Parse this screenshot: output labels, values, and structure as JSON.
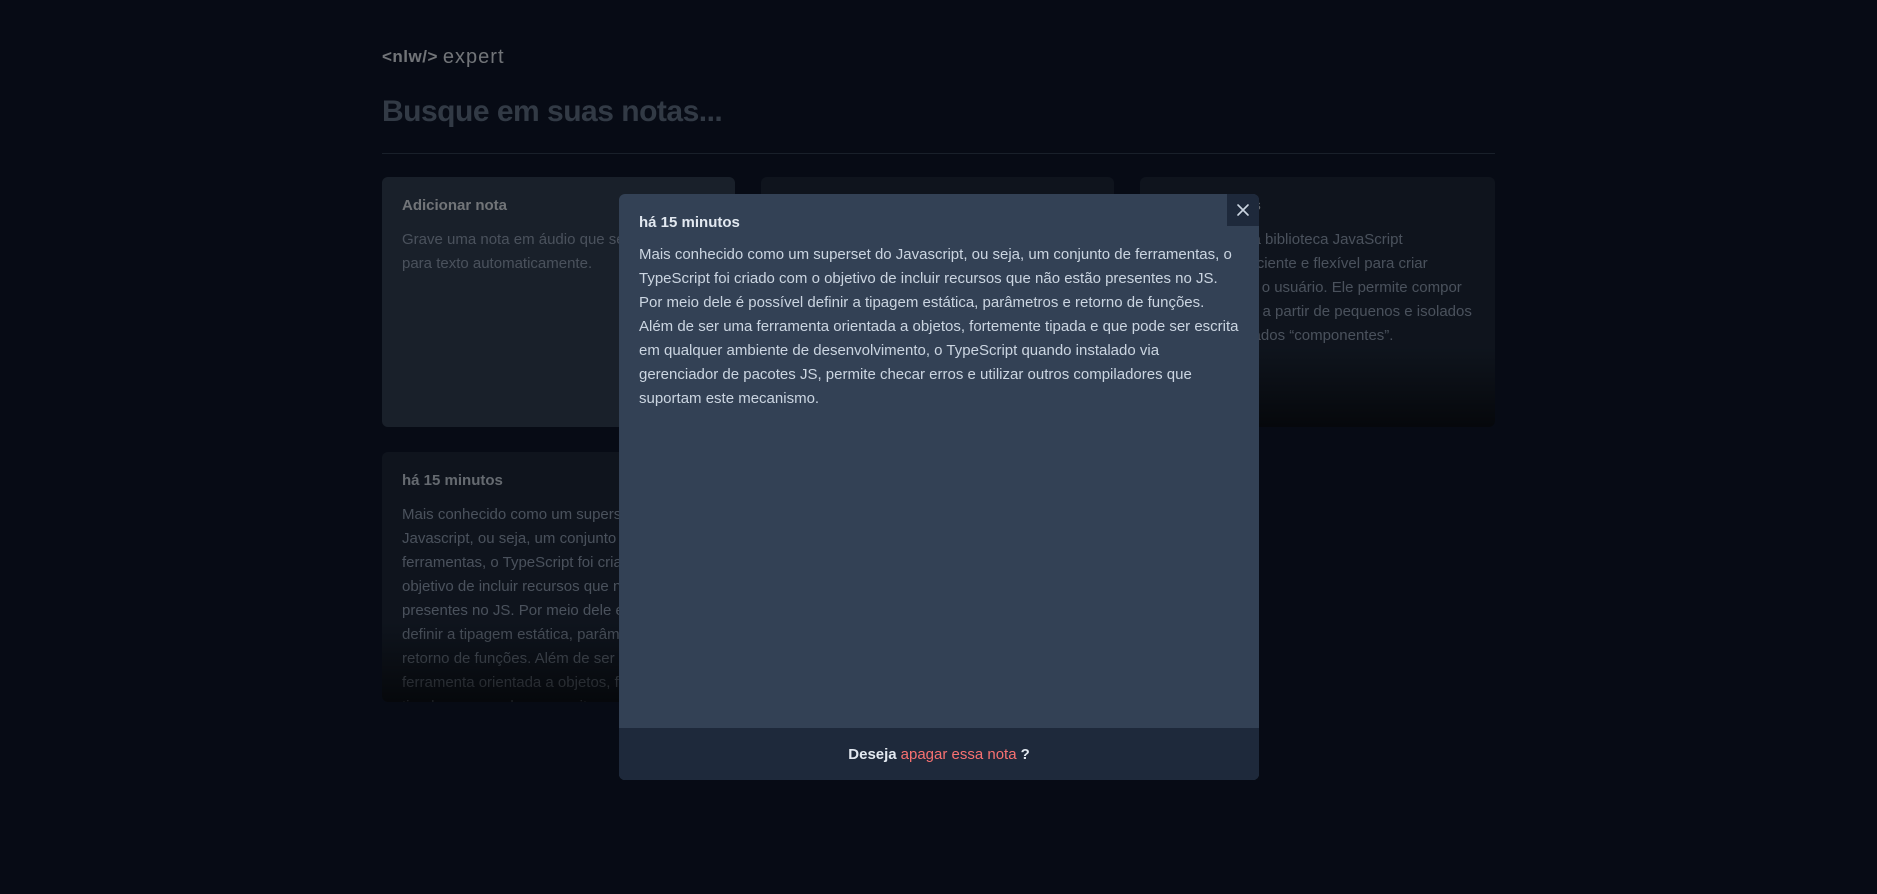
{
  "logo": {
    "prefix": "<nlw/>",
    "suffix": "expert"
  },
  "search": {
    "placeholder": "Busque em suas notas..."
  },
  "add_card": {
    "title": "Adicionar nota",
    "text": "Grave uma nota em áudio que será convertida para texto automaticamente."
  },
  "notes": [
    {
      "date": "há 15 minutos",
      "content": "O React é uma biblioteca JavaScript declarativa, eficiente e flexível para criar interfaces com o usuário. Ele permite compor UIs complexas a partir de pequenos e isolados códigos chamados “componentes”."
    },
    {
      "date": "há 15 minutos",
      "content": "Mais conhecido como um superset do Javascript, ou seja, um conjunto de ferramentas, o TypeScript foi criado com o objetivo de incluir recursos que não estão presentes no JS. Por meio dele é possível definir a tipagem estática, parâmetros e retorno de funções. Além de ser uma ferramenta orientada a objetos, fortemente tipada e que pode ser escrita em qualquer ambiente de desenvolvimento."
    }
  ],
  "modal": {
    "date": "há 15 minutos",
    "content": "Mais conhecido como um superset do Javascript, ou seja, um conjunto de ferramentas, o TypeScript foi criado com o objetivo de incluir recursos que não estão presentes no JS. Por meio dele é possível definir a tipagem estática, parâmetros e retorno de funções. Além de ser uma ferramenta orientada a objetos, fortemente tipada e que pode ser escrita em qualquer ambiente de desenvolvimento, o TypeScript quando instalado via gerenciador de pacotes JS, permite checar erros e utilizar outros compiladores que suportam este mecanismo.",
    "footer_prefix": "Deseja",
    "footer_link": "apagar essa nota",
    "footer_suffix": "?",
    "close_icon": "x-icon"
  },
  "colors": {
    "background": "#0f172a",
    "card": "#1e293b",
    "modal": "#334155",
    "danger": "#f87171"
  }
}
